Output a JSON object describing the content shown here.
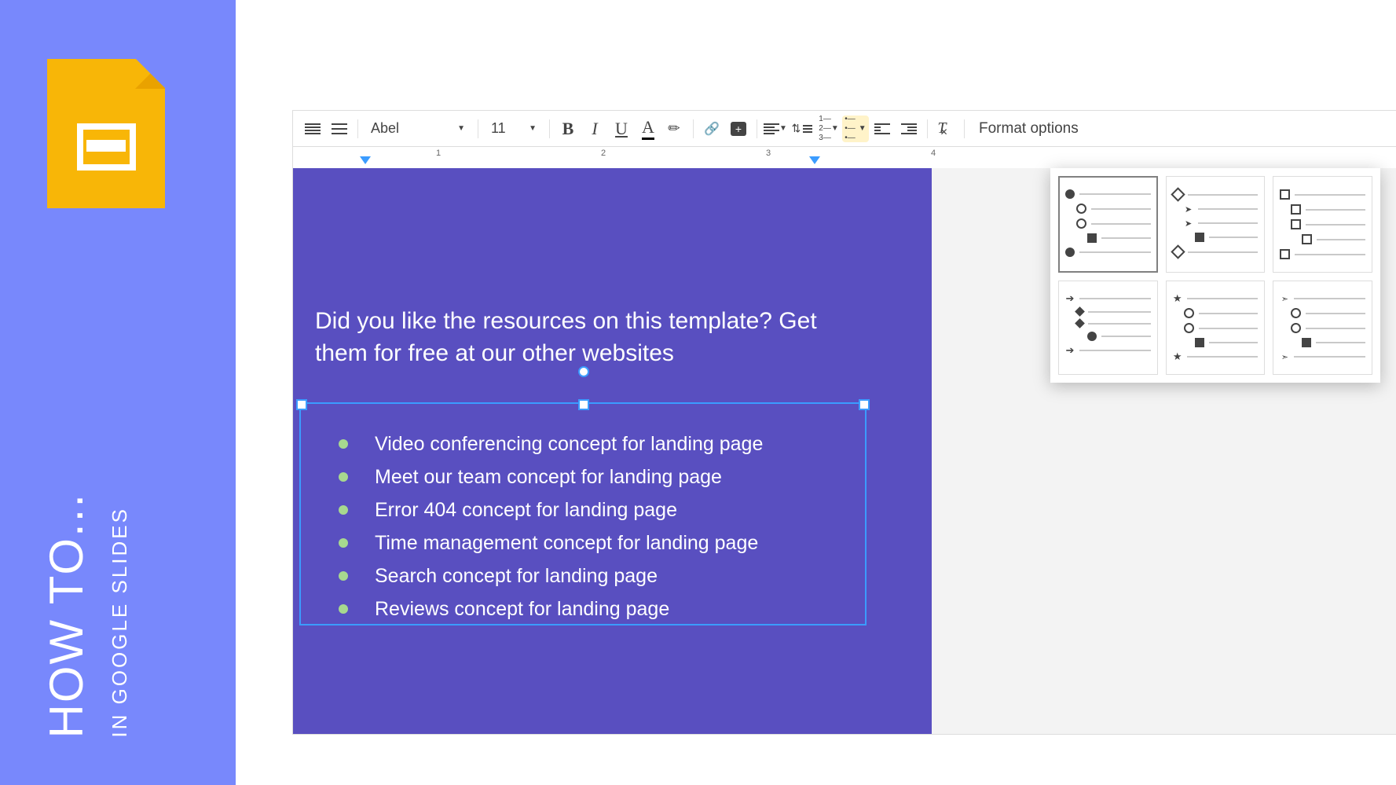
{
  "left_panel": {
    "title": "HOW TO...",
    "subtitle": "IN GOOGLE SLIDES"
  },
  "toolbar": {
    "font": "Abel",
    "font_size": "11",
    "format_options": "Format options"
  },
  "ruler": {
    "marks": [
      "1",
      "2",
      "3",
      "4"
    ]
  },
  "slide": {
    "heading": "Did you like the resources on this template? Get them for free at our other websites",
    "bullets": [
      "Video conferencing concept for landing page",
      "Meet our team concept for landing page",
      "Error 404 concept for landing page",
      "Time management concept for landing page",
      "Search concept for landing page",
      "Reviews concept for landing page"
    ]
  }
}
